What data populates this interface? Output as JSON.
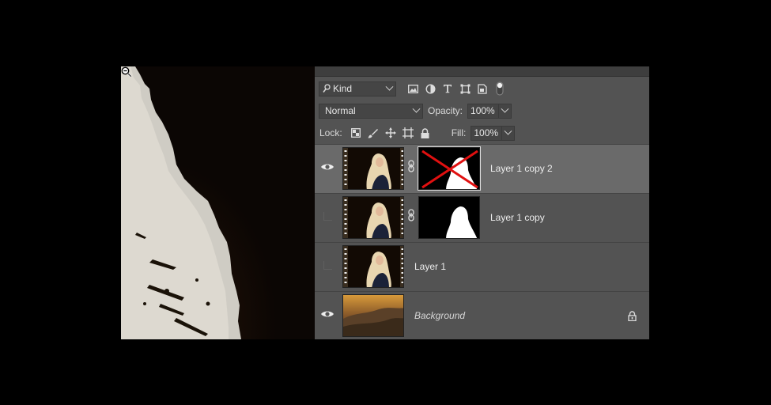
{
  "filter": {
    "kind_label": "Kind"
  },
  "blend": {
    "mode": "Normal",
    "opacity_label": "Opacity:",
    "opacity_value": "100%"
  },
  "lock": {
    "label": "Lock:",
    "fill_label": "Fill:",
    "fill_value": "100%"
  },
  "layers": [
    {
      "name": "Layer 1 copy 2",
      "visible": true,
      "has_mask": true,
      "mask_disabled": true,
      "active": true
    },
    {
      "name": "Layer 1 copy",
      "visible": false,
      "has_mask": true,
      "mask_disabled": false,
      "active": false
    },
    {
      "name": "Layer 1",
      "visible": false,
      "has_mask": false,
      "active": false
    },
    {
      "name": "Background",
      "visible": true,
      "has_mask": false,
      "locked": true,
      "italic": true,
      "active": false
    }
  ],
  "colors": {
    "panel_bg": "#535353",
    "active_row": "#6a6a6a",
    "disabled_mask_x": "#e01010"
  },
  "icons": [
    "search-icon",
    "image-filter-icon",
    "adjustment-filter-icon",
    "type-filter-icon",
    "shape-filter-icon",
    "smart-object-filter-icon",
    "filter-toggle-icon",
    "lock-pixels-icon",
    "lock-image-icon",
    "lock-position-icon",
    "lock-artboard-icon",
    "lock-all-icon",
    "eye-icon",
    "link-icon",
    "lock-icon",
    "zoom-cursor-icon"
  ]
}
